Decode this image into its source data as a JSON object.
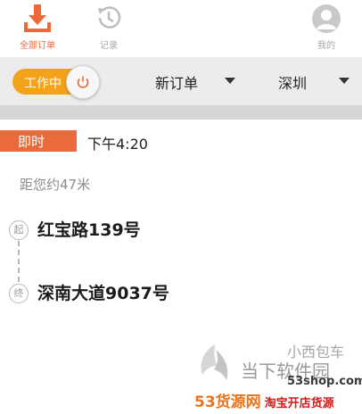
{
  "tabs": {
    "orders": {
      "label": "全部订单",
      "icon": "download-tray-icon",
      "active": true
    },
    "history": {
      "label": "记录",
      "icon": "history-clock-icon"
    },
    "me": {
      "label": "我的",
      "icon": "user-avatar-icon"
    }
  },
  "filters": {
    "work_toggle": {
      "label": "工作中",
      "state": "on",
      "icon": "power-icon"
    },
    "order_type": {
      "label": "新订单",
      "icon": "caret-down-icon"
    },
    "city": {
      "label": "深圳",
      "icon": "caret-down-icon"
    }
  },
  "order": {
    "badge": "即时",
    "time": "下午4:20",
    "distance": "距您约47米",
    "start_marker": "起",
    "from": "红宝路139号",
    "end_marker": "终",
    "to": "深南大道9037号"
  },
  "watermark": {
    "cn_name": "小西包车",
    "site_name": "当下软件园",
    "domain": "53shop.com",
    "bar_left": "53货源网",
    "bar_right": "淘宝开店货源"
  },
  "colors": {
    "accent": "#f0683a",
    "toggle": "#f3a21a",
    "badge": "#ea6a3c"
  }
}
